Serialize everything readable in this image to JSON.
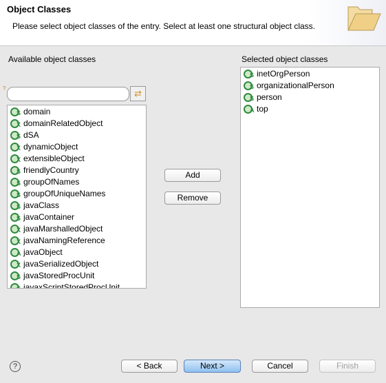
{
  "header": {
    "title": "Object Classes",
    "description": "Please select object classes of the entry. Select at least one structural object class.",
    "icon": "folder-icon"
  },
  "available": {
    "label": "Available object classes",
    "filter_value": "",
    "items": [
      {
        "name": "domain",
        "kind": "S"
      },
      {
        "name": "domainRelatedObject",
        "kind": "X"
      },
      {
        "name": "dSA",
        "kind": "S"
      },
      {
        "name": "dynamicObject",
        "kind": "X"
      },
      {
        "name": "extensibleObject",
        "kind": "X"
      },
      {
        "name": "friendlyCountry",
        "kind": "S"
      },
      {
        "name": "groupOfNames",
        "kind": "S"
      },
      {
        "name": "groupOfUniqueNames",
        "kind": "S"
      },
      {
        "name": "javaClass",
        "kind": "S"
      },
      {
        "name": "javaContainer",
        "kind": "S"
      },
      {
        "name": "javaMarshalledObject",
        "kind": "X"
      },
      {
        "name": "javaNamingReference",
        "kind": "X"
      },
      {
        "name": "javaObject",
        "kind": "A"
      },
      {
        "name": "javaSerializedObject",
        "kind": "X"
      },
      {
        "name": "javaStoredProcUnit",
        "kind": "S"
      },
      {
        "name": "javaxScriptStoredProcUnit",
        "kind": "S"
      }
    ]
  },
  "actions": {
    "add": "Add",
    "remove": "Remove"
  },
  "selected": {
    "label": "Selected object classes",
    "items": [
      {
        "name": "inetOrgPerson",
        "kind": "S"
      },
      {
        "name": "organizationalPerson",
        "kind": "S"
      },
      {
        "name": "person",
        "kind": "S"
      },
      {
        "name": "top",
        "kind": "A"
      }
    ]
  },
  "footer": {
    "help": "?",
    "back": "< Back",
    "next": "Next >",
    "cancel": "Cancel",
    "finish": "Finish"
  }
}
